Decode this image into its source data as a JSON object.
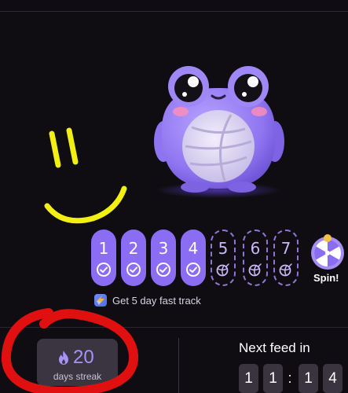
{
  "streak_days": [
    {
      "num": "1",
      "state": "done"
    },
    {
      "num": "2",
      "state": "done"
    },
    {
      "num": "3",
      "state": "done"
    },
    {
      "num": "4",
      "state": "done"
    },
    {
      "num": "5",
      "state": "pending"
    },
    {
      "num": "6",
      "state": "pending"
    },
    {
      "num": "7",
      "state": "pending"
    }
  ],
  "spin": {
    "label": "Spin!"
  },
  "fast_track": {
    "label": "Get 5 day fast track"
  },
  "streak": {
    "count": "20",
    "label": "days streak"
  },
  "next_feed": {
    "title": "Next feed in",
    "digits": [
      "1",
      "1",
      "1",
      "4"
    ],
    "separator": ":"
  },
  "colors": {
    "accent": "#8a6df2",
    "background": "#0f0d11",
    "annotation_red": "#e01010",
    "annotation_yellow": "#f2ef12"
  },
  "icons": {
    "done": "check-circle-icon",
    "pending": "yarn-ball-icon",
    "streak": "flame-icon",
    "fast_track": "fast-track-icon",
    "spin": "spin-wheel-icon"
  }
}
